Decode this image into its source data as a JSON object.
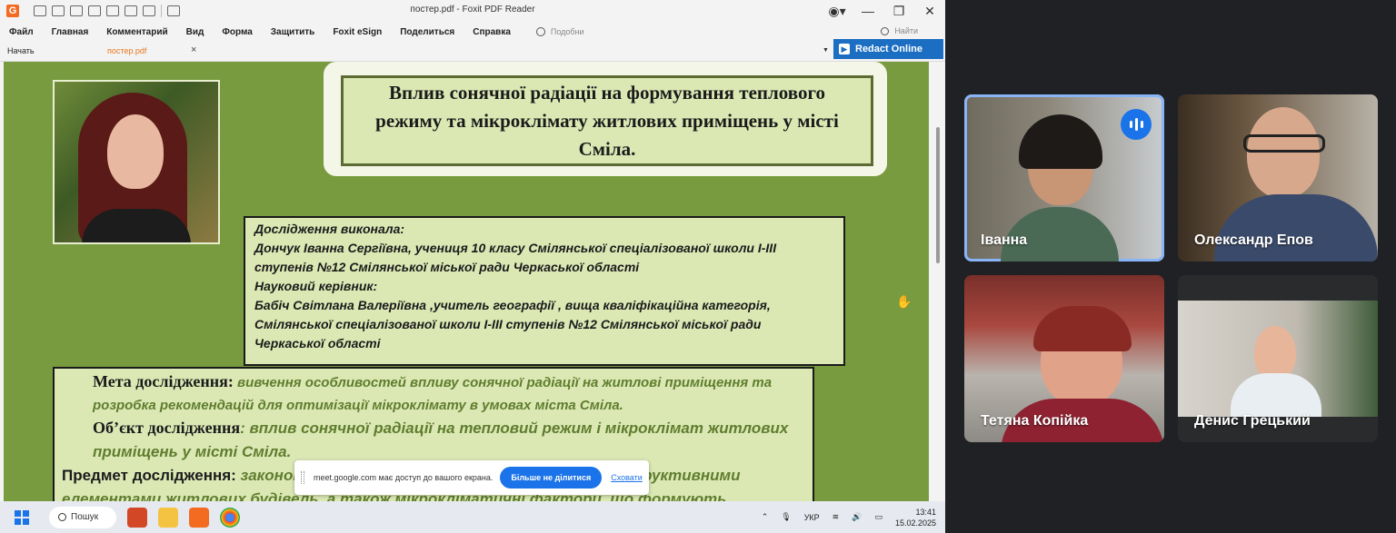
{
  "window": {
    "title": "постер.pdf - Foxit PDF Reader",
    "app_logo": "G",
    "menu": [
      "Файл",
      "Главная",
      "Комментарий",
      "Вид",
      "Форма",
      "Защитить",
      "Foxit eSign",
      "Поделиться",
      "Справка"
    ],
    "tell_me_placeholder": "Подобни",
    "search_placeholder": "Найти",
    "tabs": [
      {
        "label": "Начать",
        "active": false
      },
      {
        "label": "постер.pdf",
        "active": true
      }
    ],
    "tab_close": "×",
    "redact_label": "Redact Online",
    "win_controls": {
      "minimize": "—",
      "maximize": "❐",
      "close": "✕",
      "account": "◉▾"
    }
  },
  "poster": {
    "title": "Вплив сонячної радіації на формування теплового режиму та мікроклімату житлових приміщень у місті Сміла.",
    "author_lines": [
      "Дослідження виконала:",
      " Дончук Іванна Сергіївна, учениця 10 класу Смілянської спеціалізованої школи І-ІІІ ступенів №12 Смілянської міської ради Черкаської області",
      "Науковий керівник:",
      "Бабіч Світлана Валеріївна ,учитель географії , вища кваліфікаційна категорія, Смілянської спеціалізованої школи І-ІІІ ступенів №12 Смілянської міської ради Черкаської області"
    ],
    "goal_label": "Мета дослідження:",
    "goal_text": " вивчення особливостей впливу сонячної радіації на житлові приміщення та розробка рекомендацій для оптимізації мікроклімату в умовах міста Сміла.",
    "object_label": "Об’єкт дослідження",
    "object_text": ":  вплив сонячної радіації на тепловий режим і мікроклімат житлових приміщень у місті Сміла.",
    "subject_label": "Предмет дослідження:",
    "subject_text": " закономірності взаємодії сонячної радіації з конструктивними елементами житлових будівель, а також мікрокліматичні фактори, що формують"
  },
  "share_bar": {
    "message": "meet.google.com має доступ до вашого екрана.",
    "stop_label": "Більше не ділитися",
    "hide_label": "Сховати"
  },
  "taskbar": {
    "search_label": "Пошук",
    "lang": "УКР",
    "time": "13:41",
    "date": "15.02.2025"
  },
  "participants": [
    {
      "name": "Іванна",
      "speaking": true
    },
    {
      "name": "Олександр Епов",
      "speaking": false
    },
    {
      "name": "Тетяна Копійка",
      "speaking": false
    },
    {
      "name": "Денис Грецький",
      "speaking": false
    }
  ],
  "colors": {
    "poster_bg": "#789b3f",
    "box_bg": "#dbe8b4",
    "accent_text": "#5f7d2e",
    "meet_bg": "#202124",
    "active_outline": "#8ab4f8",
    "button_blue": "#1a73e8"
  }
}
